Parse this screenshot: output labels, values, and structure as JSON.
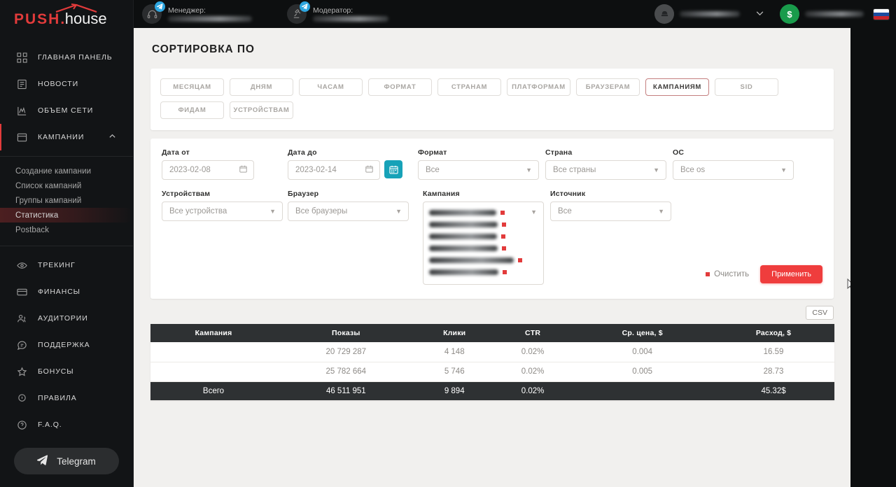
{
  "brand": {
    "push": "PUSH",
    "dot": ".",
    "house": "house",
    "accent": "#e23b3b"
  },
  "sidebar": {
    "items": [
      {
        "label": "Главная панель",
        "icon": "grid-icon"
      },
      {
        "label": "Новости",
        "icon": "news-icon"
      },
      {
        "label": "Объем сети",
        "icon": "chart-icon"
      },
      {
        "label": "Кампании",
        "icon": "campaign-icon",
        "expanded": true
      },
      {
        "label": "Трекинг",
        "icon": "eye-icon"
      },
      {
        "label": "Финансы",
        "icon": "card-icon"
      },
      {
        "label": "Аудитории",
        "icon": "users-icon"
      },
      {
        "label": "Поддержка",
        "icon": "support-icon"
      },
      {
        "label": "Бонусы",
        "icon": "star-icon"
      },
      {
        "label": "Правила",
        "icon": "info-icon"
      },
      {
        "label": "F.A.Q.",
        "icon": "question-icon"
      }
    ],
    "subitems": [
      {
        "label": "Создание кампании",
        "current": false
      },
      {
        "label": "Список кампаний",
        "current": false
      },
      {
        "label": "Группы кампаний",
        "current": false
      },
      {
        "label": "Статистика",
        "current": true
      },
      {
        "label": "Postback",
        "current": false
      }
    ],
    "telegram_button": "Telegram"
  },
  "topbar": {
    "manager": {
      "role": "Менеджер:",
      "icon": "headset-icon",
      "badge": "telegram-icon",
      "name": ""
    },
    "moderator": {
      "role": "Модератор:",
      "icon": "gavel-icon",
      "badge": "telegram-icon",
      "name": ""
    },
    "account": {
      "icon": "avatar-icon",
      "name": "",
      "chevron": "chevron-down-icon"
    },
    "balance": {
      "currency": "$",
      "amount": ""
    },
    "language": "ru"
  },
  "page": {
    "title": "Сортировка по"
  },
  "sort_tabs": [
    {
      "label": "Месяцам",
      "active": false
    },
    {
      "label": "Дням",
      "active": false
    },
    {
      "label": "Часам",
      "active": false
    },
    {
      "label": "Формат",
      "active": false
    },
    {
      "label": "Странам",
      "active": false
    },
    {
      "label": "Платформам",
      "active": false
    },
    {
      "label": "Браузерам",
      "active": false
    },
    {
      "label": "Кампаниям",
      "active": true
    },
    {
      "label": "SID",
      "active": false
    },
    {
      "label": "Фидам",
      "active": false
    },
    {
      "label": "Устройствам",
      "active": false
    }
  ],
  "filters": {
    "date_from": {
      "label": "Дата от",
      "value": "2023-02-08",
      "icon": "calendar-icon"
    },
    "date_to": {
      "label": "Дата до",
      "value": "2023-02-14",
      "icon": "calendar-icon"
    },
    "calendar_button": {
      "icon": "calendar-icon"
    },
    "format": {
      "label": "Формат",
      "value": "Все"
    },
    "country": {
      "label": "Страна",
      "value": "Все страны"
    },
    "os": {
      "label": "ОС",
      "value": "Все os"
    },
    "devices": {
      "label": "Устройствам",
      "value": "Все устройства"
    },
    "browser": {
      "label": "Браузер",
      "value": "Все браузеры"
    },
    "campaign": {
      "label": "Кампания",
      "selected_count": 6
    },
    "source": {
      "label": "Источник",
      "value": "Все"
    },
    "clear": "Очистить",
    "apply": "Применить",
    "apply_color": "#ef3d3d"
  },
  "export": {
    "csv_label": "CSV"
  },
  "table": {
    "columns": [
      "Кампания",
      "Показы",
      "Клики",
      "CTR",
      "Ср. цена, $",
      "Расход, $"
    ],
    "rows": [
      {
        "campaign": "",
        "impressions": "20 729 287",
        "clicks": "4 148",
        "ctr": "0.02%",
        "avg_price": "0.004",
        "spend": "16.59"
      },
      {
        "campaign": "",
        "impressions": "25 782 664",
        "clicks": "5 746",
        "ctr": "0.02%",
        "avg_price": "0.005",
        "spend": "28.73"
      }
    ],
    "total": {
      "label": "Всего",
      "impressions": "46 511 951",
      "clicks": "9 894",
      "ctr": "0.02%",
      "avg_price": "",
      "spend": "45.32$"
    }
  }
}
